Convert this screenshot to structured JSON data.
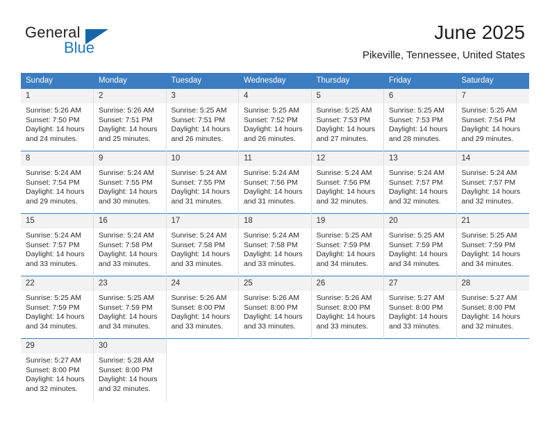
{
  "logo": {
    "word_one": "General",
    "word_two": "Blue",
    "triangle_color": "#1466a8"
  },
  "header": {
    "title": "June 2025",
    "location": "Pikeville, Tennessee, United States"
  },
  "theme": {
    "header_blue": "#3b7dc0",
    "daynum_bg": "#f2f2f2",
    "grid_line": "#dcdcdc",
    "text": "#2b2b2b"
  },
  "labels": {
    "sunrise_prefix": "Sunrise:",
    "sunset_prefix": "Sunset:",
    "daylight_prefix": "Daylight:"
  },
  "columns": [
    "Sunday",
    "Monday",
    "Tuesday",
    "Wednesday",
    "Thursday",
    "Friday",
    "Saturday"
  ],
  "weeks": [
    [
      {
        "day": "1",
        "sunrise": "Sunrise: 5:26 AM",
        "sunset": "Sunset: 7:50 PM",
        "daylight": "Daylight: 14 hours and 24 minutes."
      },
      {
        "day": "2",
        "sunrise": "Sunrise: 5:26 AM",
        "sunset": "Sunset: 7:51 PM",
        "daylight": "Daylight: 14 hours and 25 minutes."
      },
      {
        "day": "3",
        "sunrise": "Sunrise: 5:25 AM",
        "sunset": "Sunset: 7:51 PM",
        "daylight": "Daylight: 14 hours and 26 minutes."
      },
      {
        "day": "4",
        "sunrise": "Sunrise: 5:25 AM",
        "sunset": "Sunset: 7:52 PM",
        "daylight": "Daylight: 14 hours and 26 minutes."
      },
      {
        "day": "5",
        "sunrise": "Sunrise: 5:25 AM",
        "sunset": "Sunset: 7:53 PM",
        "daylight": "Daylight: 14 hours and 27 minutes."
      },
      {
        "day": "6",
        "sunrise": "Sunrise: 5:25 AM",
        "sunset": "Sunset: 7:53 PM",
        "daylight": "Daylight: 14 hours and 28 minutes."
      },
      {
        "day": "7",
        "sunrise": "Sunrise: 5:25 AM",
        "sunset": "Sunset: 7:54 PM",
        "daylight": "Daylight: 14 hours and 29 minutes."
      }
    ],
    [
      {
        "day": "8",
        "sunrise": "Sunrise: 5:24 AM",
        "sunset": "Sunset: 7:54 PM",
        "daylight": "Daylight: 14 hours and 29 minutes."
      },
      {
        "day": "9",
        "sunrise": "Sunrise: 5:24 AM",
        "sunset": "Sunset: 7:55 PM",
        "daylight": "Daylight: 14 hours and 30 minutes."
      },
      {
        "day": "10",
        "sunrise": "Sunrise: 5:24 AM",
        "sunset": "Sunset: 7:55 PM",
        "daylight": "Daylight: 14 hours and 31 minutes."
      },
      {
        "day": "11",
        "sunrise": "Sunrise: 5:24 AM",
        "sunset": "Sunset: 7:56 PM",
        "daylight": "Daylight: 14 hours and 31 minutes."
      },
      {
        "day": "12",
        "sunrise": "Sunrise: 5:24 AM",
        "sunset": "Sunset: 7:56 PM",
        "daylight": "Daylight: 14 hours and 32 minutes."
      },
      {
        "day": "13",
        "sunrise": "Sunrise: 5:24 AM",
        "sunset": "Sunset: 7:57 PM",
        "daylight": "Daylight: 14 hours and 32 minutes."
      },
      {
        "day": "14",
        "sunrise": "Sunrise: 5:24 AM",
        "sunset": "Sunset: 7:57 PM",
        "daylight": "Daylight: 14 hours and 32 minutes."
      }
    ],
    [
      {
        "day": "15",
        "sunrise": "Sunrise: 5:24 AM",
        "sunset": "Sunset: 7:57 PM",
        "daylight": "Daylight: 14 hours and 33 minutes."
      },
      {
        "day": "16",
        "sunrise": "Sunrise: 5:24 AM",
        "sunset": "Sunset: 7:58 PM",
        "daylight": "Daylight: 14 hours and 33 minutes."
      },
      {
        "day": "17",
        "sunrise": "Sunrise: 5:24 AM",
        "sunset": "Sunset: 7:58 PM",
        "daylight": "Daylight: 14 hours and 33 minutes."
      },
      {
        "day": "18",
        "sunrise": "Sunrise: 5:24 AM",
        "sunset": "Sunset: 7:58 PM",
        "daylight": "Daylight: 14 hours and 33 minutes."
      },
      {
        "day": "19",
        "sunrise": "Sunrise: 5:25 AM",
        "sunset": "Sunset: 7:59 PM",
        "daylight": "Daylight: 14 hours and 34 minutes."
      },
      {
        "day": "20",
        "sunrise": "Sunrise: 5:25 AM",
        "sunset": "Sunset: 7:59 PM",
        "daylight": "Daylight: 14 hours and 34 minutes."
      },
      {
        "day": "21",
        "sunrise": "Sunrise: 5:25 AM",
        "sunset": "Sunset: 7:59 PM",
        "daylight": "Daylight: 14 hours and 34 minutes."
      }
    ],
    [
      {
        "day": "22",
        "sunrise": "Sunrise: 5:25 AM",
        "sunset": "Sunset: 7:59 PM",
        "daylight": "Daylight: 14 hours and 34 minutes."
      },
      {
        "day": "23",
        "sunrise": "Sunrise: 5:25 AM",
        "sunset": "Sunset: 7:59 PM",
        "daylight": "Daylight: 14 hours and 34 minutes."
      },
      {
        "day": "24",
        "sunrise": "Sunrise: 5:26 AM",
        "sunset": "Sunset: 8:00 PM",
        "daylight": "Daylight: 14 hours and 33 minutes."
      },
      {
        "day": "25",
        "sunrise": "Sunrise: 5:26 AM",
        "sunset": "Sunset: 8:00 PM",
        "daylight": "Daylight: 14 hours and 33 minutes."
      },
      {
        "day": "26",
        "sunrise": "Sunrise: 5:26 AM",
        "sunset": "Sunset: 8:00 PM",
        "daylight": "Daylight: 14 hours and 33 minutes."
      },
      {
        "day": "27",
        "sunrise": "Sunrise: 5:27 AM",
        "sunset": "Sunset: 8:00 PM",
        "daylight": "Daylight: 14 hours and 33 minutes."
      },
      {
        "day": "28",
        "sunrise": "Sunrise: 5:27 AM",
        "sunset": "Sunset: 8:00 PM",
        "daylight": "Daylight: 14 hours and 32 minutes."
      }
    ],
    [
      {
        "day": "29",
        "sunrise": "Sunrise: 5:27 AM",
        "sunset": "Sunset: 8:00 PM",
        "daylight": "Daylight: 14 hours and 32 minutes."
      },
      {
        "day": "30",
        "sunrise": "Sunrise: 5:28 AM",
        "sunset": "Sunset: 8:00 PM",
        "daylight": "Daylight: 14 hours and 32 minutes."
      },
      {
        "day": "",
        "sunrise": "",
        "sunset": "",
        "daylight": ""
      },
      {
        "day": "",
        "sunrise": "",
        "sunset": "",
        "daylight": ""
      },
      {
        "day": "",
        "sunrise": "",
        "sunset": "",
        "daylight": ""
      },
      {
        "day": "",
        "sunrise": "",
        "sunset": "",
        "daylight": ""
      },
      {
        "day": "",
        "sunrise": "",
        "sunset": "",
        "daylight": ""
      }
    ]
  ]
}
